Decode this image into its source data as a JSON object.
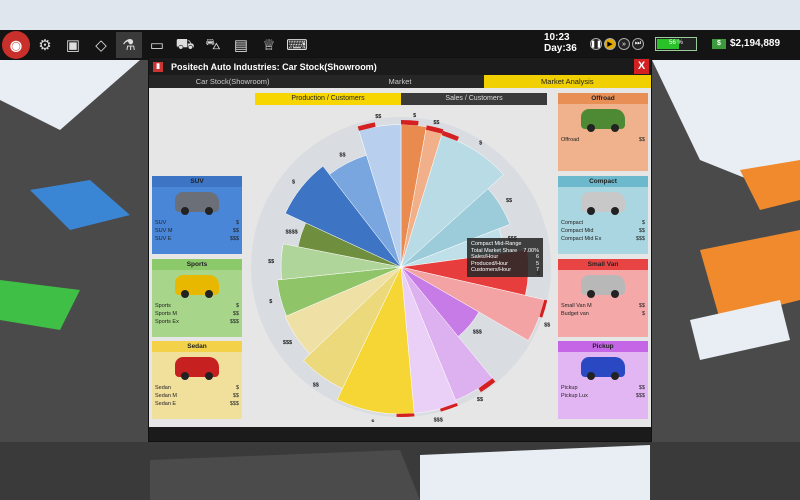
{
  "topbar": {
    "icons": [
      "logo-icon",
      "gear-icon",
      "save-icon",
      "road-icon",
      "research-icon",
      "tv-icon",
      "showroom-icon",
      "cars-icon",
      "chart-icon",
      "trophy-icon",
      "computer-icon"
    ],
    "time": "10:23",
    "day": "Day:36",
    "battery_text": "56 %",
    "battery_level_percent": 56,
    "money": "$2,194,889"
  },
  "window": {
    "title": "Positech Auto Industries: Car Stock(Showroom)",
    "close": "X",
    "tabs": [
      "Car Stock(Showroom)",
      "Market",
      "Market Analysis"
    ],
    "active_tab": 2,
    "subtabs": [
      "Production / Customers",
      "Sales / Customers"
    ],
    "active_subtab": 0
  },
  "categories": {
    "suv": {
      "title": "SUV",
      "color": "#4a86d8",
      "head": "#3d74c4",
      "car": "#6b6f78",
      "rows": [
        [
          "SUV",
          "$"
        ],
        [
          "SUV M",
          "$$"
        ],
        [
          "SUV E",
          "$$$"
        ]
      ]
    },
    "sports": {
      "title": "Sports",
      "color": "#a7d58a",
      "head": "#8cc96a",
      "car": "#e8b800",
      "rows": [
        [
          "Sports",
          "$"
        ],
        [
          "Sports M",
          "$$"
        ],
        [
          "Sports Ex",
          "$$$"
        ]
      ]
    },
    "sedan": {
      "title": "Sedan",
      "color": "#f1e09c",
      "head": "#f3d24a",
      "car": "#c72020",
      "rows": [
        [
          "Sedan",
          "$"
        ],
        [
          "Sedan M",
          "$$"
        ],
        [
          "Sedan E",
          "$$$"
        ]
      ]
    },
    "offroad": {
      "title": "Offroad",
      "color": "#f0b28c",
      "head": "#e88f56",
      "car": "#4e8a34",
      "rows": [
        [
          "Offroad",
          "$$"
        ]
      ]
    },
    "compact": {
      "title": "Compact",
      "color": "#a9d6e0",
      "head": "#6cb8cc",
      "car": "#c8c8c8",
      "rows": [
        [
          "Compact",
          "$"
        ],
        [
          "Compact Mid",
          "$$"
        ],
        [
          "Compact Mid Ex",
          "$$$"
        ]
      ]
    },
    "smallvan": {
      "title": "Small Van",
      "color": "#f4a8a8",
      "head": "#e94444",
      "car": "#b8b8b8",
      "rows": [
        [
          "Small Van M",
          "$$"
        ],
        [
          "Budget van",
          "$"
        ]
      ]
    },
    "pickup": {
      "title": "Pickup",
      "color": "#e2b6f2",
      "head": "#c466e6",
      "car": "#2a48c2",
      "rows": [
        [
          "Pickup",
          "$$"
        ],
        [
          "Pickup Lux",
          "$$$"
        ]
      ]
    }
  },
  "tooltip": {
    "lines": [
      [
        "Compact  Mid-Range",
        ""
      ],
      [
        "Total Market Share",
        "7.00%"
      ],
      [
        "Sales/Hour",
        "6"
      ],
      [
        "Produced/Hour",
        "5"
      ],
      [
        "Customers/Hour",
        "7"
      ]
    ]
  },
  "pie": {
    "segments": [
      {
        "label": "$",
        "color": "#e98a4e",
        "r": 0.95,
        "inner": 0.0
      },
      {
        "label": "$$",
        "color": "#f2b08a",
        "r": 0.93,
        "inner": 0.0
      },
      {
        "label": "$",
        "color": "#b9dbe6",
        "r": 0.92,
        "inner": 0.0
      },
      {
        "label": "$$",
        "color": "#9ccbd9",
        "r": 0.78,
        "inner": 0.0
      },
      {
        "label": "$$$",
        "color": "#bfe0e8",
        "r": 0.7,
        "inner": 0.0
      },
      {
        "label": "$",
        "color": "#e83d3d",
        "r": 0.85,
        "inner": 0.0
      },
      {
        "label": "$$",
        "color": "#f3a3a3",
        "r": 0.98,
        "inner": 0.0
      },
      {
        "label": "$$$",
        "color": "#c77be6",
        "r": 0.6,
        "inner": 0.0
      },
      {
        "label": "$$",
        "color": "#ddb0f0",
        "r": 0.96,
        "inner": 0.0
      },
      {
        "label": "$$$",
        "color": "#eacff6",
        "r": 0.98,
        "inner": 0.0
      },
      {
        "label": "$",
        "color": "#f5d634",
        "r": 0.98,
        "inner": 0.0
      },
      {
        "label": "$$",
        "color": "#ecd97c",
        "r": 0.9,
        "inner": 0.0
      },
      {
        "label": "$$$",
        "color": "#efe0a6",
        "r": 0.84,
        "inner": 0.0
      },
      {
        "label": "$",
        "color": "#8fc469",
        "r": 0.83,
        "inner": 0.0
      },
      {
        "label": "$$",
        "color": "#b0d59a",
        "r": 0.8,
        "inner": 0.0
      },
      {
        "label": "$$$$",
        "color": "#6f8f3e",
        "r": 0.7,
        "inner": 0.0
      },
      {
        "label": "$",
        "color": "#3d74c4",
        "r": 0.85,
        "inner": 0.0
      },
      {
        "label": "$$",
        "color": "#7aa6e0",
        "r": 0.78,
        "inner": 0.0
      },
      {
        "label": "$$",
        "color": "#b8cfee",
        "r": 0.95,
        "inner": 0.0
      }
    ],
    "weights": [
      3,
      2,
      9,
      6,
      4,
      6,
      5,
      6,
      5,
      5,
      9,
      6,
      6,
      5,
      5,
      4,
      8,
      6,
      5
    ]
  }
}
